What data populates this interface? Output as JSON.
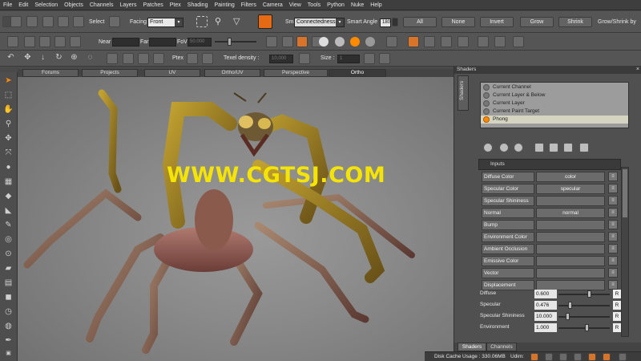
{
  "menu": [
    "File",
    "Edit",
    "Selection",
    "Objects",
    "Channels",
    "Layers",
    "Patches",
    "Ptex",
    "Shading",
    "Painting",
    "Filters",
    "Camera",
    "View",
    "Tools",
    "Python",
    "Nuke",
    "Help"
  ],
  "toolbar1": {
    "select_label": "Select",
    "facing_label": "Facing",
    "facing_value": "Front",
    "smart_type_label": "Smart Type:",
    "smart_type_value": "Connectedness",
    "smart_angle_label": "Smart Angle",
    "smart_angle_value": "180",
    "all_label": "All",
    "none_label": "None",
    "invert_label": "Invert",
    "grow_label": "Grow",
    "shrink_label": "Shrink",
    "grow_shrink_label": "Grow/Shrink by"
  },
  "toolbar2": {
    "near_label": "Near",
    "far_label": "Far",
    "fov_label": "FoV",
    "fov_value": "50.000"
  },
  "toolbar3": {
    "ptex_label": "Ptex",
    "texel_density_label": "Texel density :",
    "texel_density_value": "10,000",
    "size_label": "Size :",
    "size_value": "1"
  },
  "viewport_tabs": [
    "Forums",
    "Projects",
    "UV",
    "Ortho/UV",
    "Perspective",
    "Ortho"
  ],
  "active_tab": "Ortho",
  "watermark": "WWW.CGTSJ.COM",
  "shaders_panel": {
    "title": "Shaders",
    "close": "×",
    "side_tab": "Shaders",
    "channels": [
      "Current Channel",
      "Current Layer & Below",
      "Current Layer",
      "Current Paint Target",
      "Phong"
    ],
    "selected_channel": "Phong",
    "inputs_label": "Inputs",
    "shader_inputs": [
      {
        "name": "Diffuse Color",
        "value": "color"
      },
      {
        "name": "Specular Color",
        "value": "specular"
      },
      {
        "name": "Specular Shininess",
        "value": ""
      },
      {
        "name": "Normal",
        "value": "normal"
      },
      {
        "name": "Bump",
        "value": ""
      },
      {
        "name": "Environment Color",
        "value": ""
      },
      {
        "name": "Ambient Occlusion",
        "value": ""
      },
      {
        "name": "Emissive Color",
        "value": ""
      },
      {
        "name": "Vector",
        "value": ""
      },
      {
        "name": "Displacement",
        "value": ""
      }
    ],
    "sliders": [
      {
        "name": "Diffuse",
        "value": "0.600",
        "level": 0.6,
        "reset": "R"
      },
      {
        "name": "Specular",
        "value": "0.476",
        "level": 0.2,
        "reset": "R"
      },
      {
        "name": "Specular Shininess",
        "value": "10.000",
        "level": 0.15,
        "reset": "R"
      },
      {
        "name": "Environment",
        "value": "1.000",
        "level": 0.55,
        "reset": "R"
      }
    ],
    "bottom_tabs": [
      "Shaders",
      "Channels"
    ]
  },
  "status": {
    "disk_cache": "Disk Cache Usage : 330.06MB",
    "udim": "Udim:"
  },
  "colors": {
    "accent_orange": "#ff8a00",
    "watermark_yellow": "#f5e400"
  }
}
